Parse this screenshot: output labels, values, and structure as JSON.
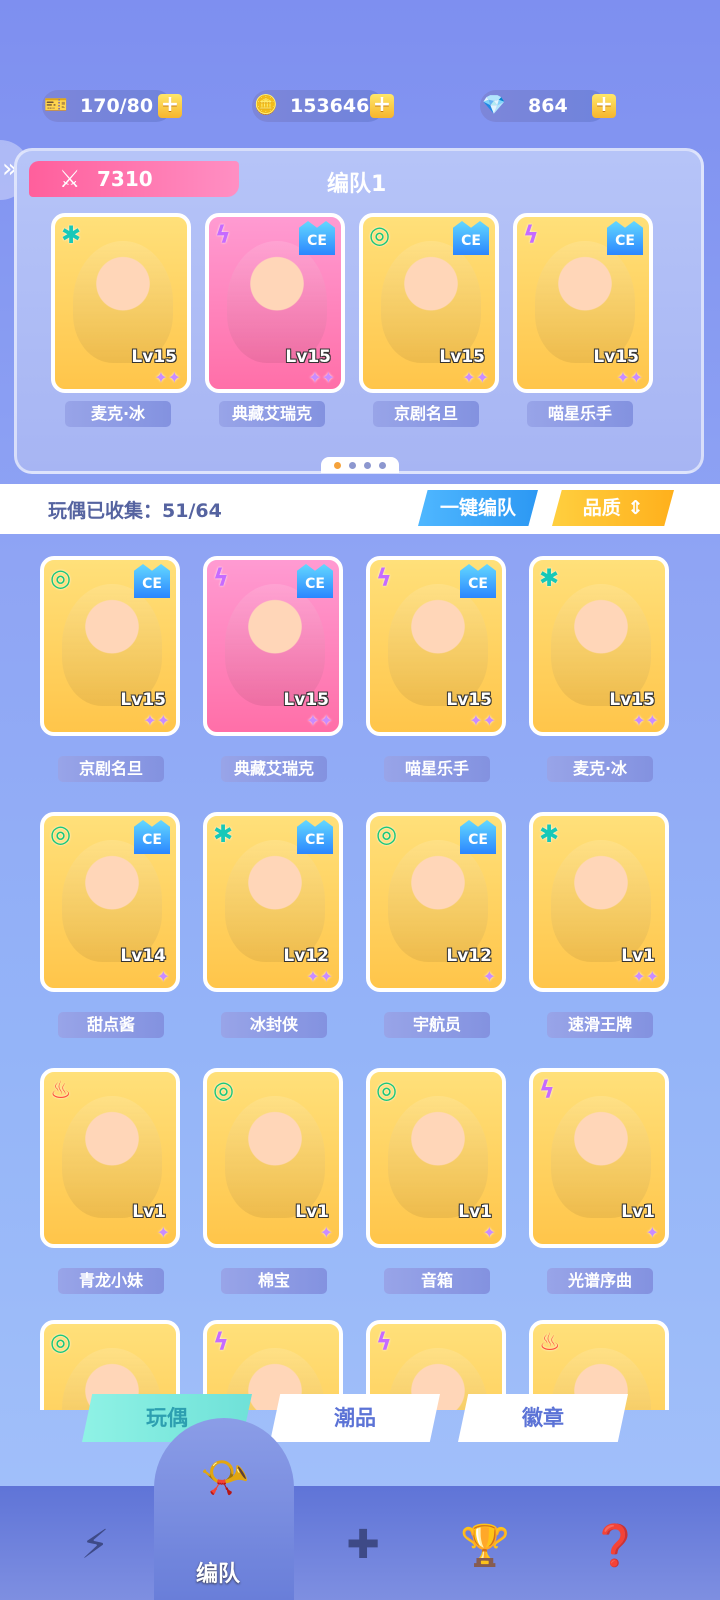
{
  "resources": [
    {
      "value": "170/80",
      "icon": "ticket-icon"
    },
    {
      "value": "153646",
      "icon": "gold-coin-icon"
    },
    {
      "value": "864",
      "icon": "crystal-icon"
    }
  ],
  "team": {
    "power": "7310",
    "title": "编队1",
    "members": [
      {
        "name": "麦克·冰",
        "level": "Lv15"
      },
      {
        "name": "典藏艾瑞克",
        "level": "Lv15"
      },
      {
        "name": "京剧名旦",
        "level": "Lv15"
      },
      {
        "name": "喵星乐手",
        "level": "Lv15"
      }
    ]
  },
  "collection": {
    "collected_text": "玩偶已收集：51/64",
    "auto_team_label": "一键编队",
    "sort_label": "品质"
  },
  "cards": [
    {
      "name": "京剧名旦",
      "level": "Lv15"
    },
    {
      "name": "典藏艾瑞克",
      "level": "Lv15"
    },
    {
      "name": "喵星乐手",
      "level": "Lv15"
    },
    {
      "name": "麦克·冰",
      "level": "Lv15"
    },
    {
      "name": "甜点酱",
      "level": "Lv14"
    },
    {
      "name": "冰封侠",
      "level": "Lv12"
    },
    {
      "name": "宇航员",
      "level": "Lv12"
    },
    {
      "name": "速滑王牌",
      "level": "Lv1"
    },
    {
      "name": "青龙小妹",
      "level": "Lv1"
    },
    {
      "name": "棉宝",
      "level": "Lv1"
    },
    {
      "name": "音箱",
      "level": "Lv1"
    },
    {
      "name": "光谱序曲",
      "level": "Lv1"
    }
  ],
  "tabs": [
    "玩偶",
    "潮品",
    "徽章"
  ],
  "nav": {
    "center_label": "编队"
  }
}
